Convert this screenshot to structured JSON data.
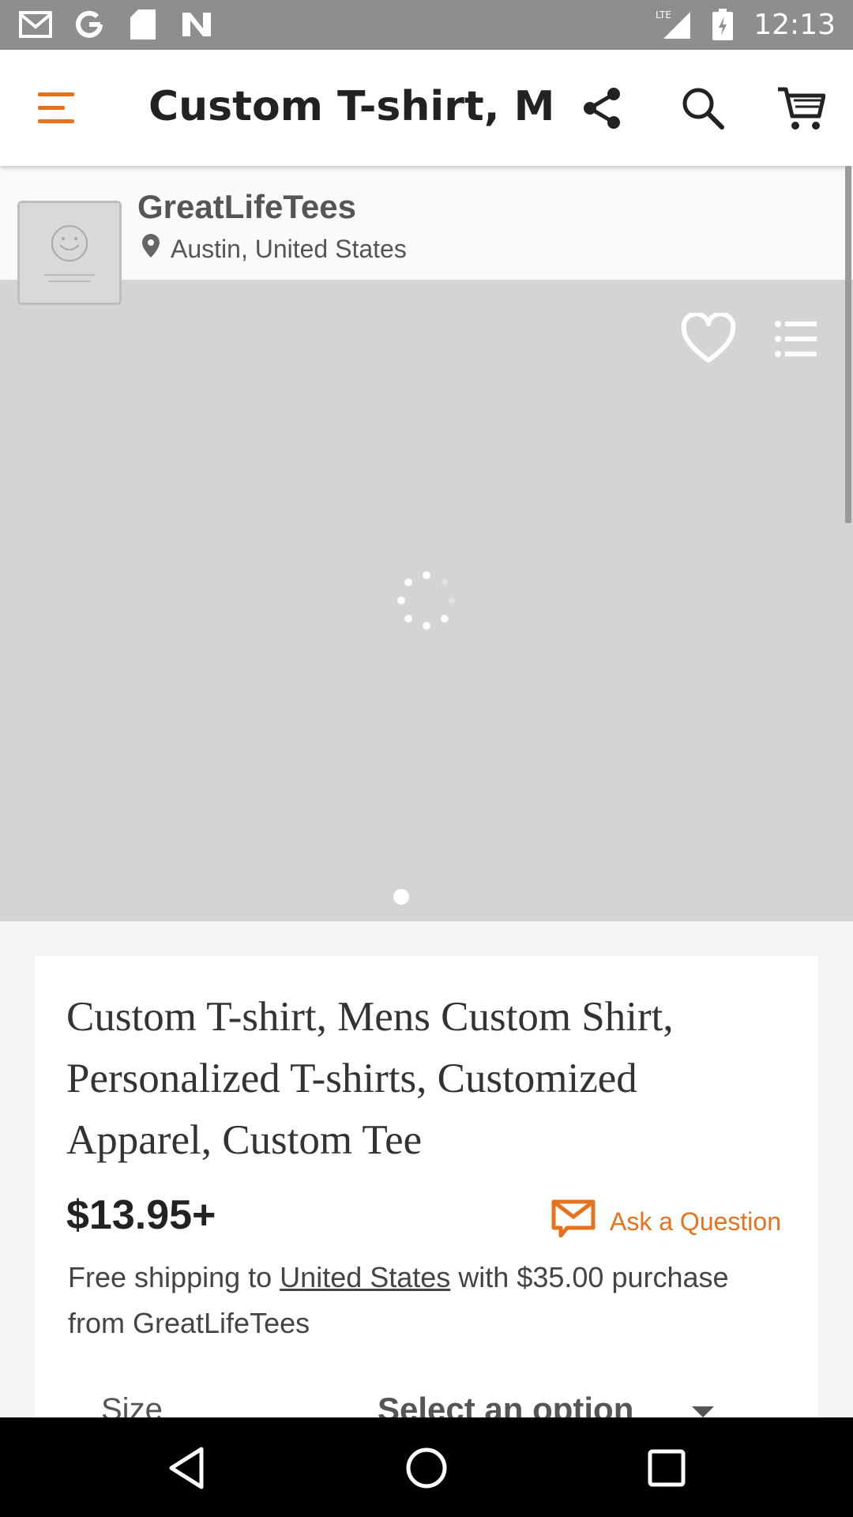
{
  "status_bar": {
    "time": "12:13",
    "network": "LTE",
    "icons": [
      "gmail-icon",
      "google-icon",
      "sd-card-icon",
      "news-icon",
      "signal-icon",
      "battery-charging-icon"
    ]
  },
  "toolbar": {
    "title": "Custom T-shirt, M...",
    "icons": [
      "menu-icon",
      "share-icon",
      "search-icon",
      "cart-icon"
    ],
    "accent_color": "#e8711e"
  },
  "shop": {
    "name": "GreatLifeTees",
    "location": "Austin, United States"
  },
  "gallery": {
    "state": "loading",
    "page_count": 1,
    "current_page": 1
  },
  "product": {
    "title": "Custom T-shirt, Mens Custom Shirt, Personalized T-shirts, Customized Apparel, Custom Tee",
    "price": "$13.95+",
    "ask_label": "Ask a Question",
    "shipping": {
      "prefix": "Free shipping to",
      "country": "United States",
      "suffix": "with $35.00 purchase from GreatLifeTees"
    },
    "size": {
      "label": "Size",
      "value": "Select an option"
    }
  },
  "nav": {
    "icons": [
      "back-icon",
      "home-icon",
      "recents-icon"
    ]
  }
}
